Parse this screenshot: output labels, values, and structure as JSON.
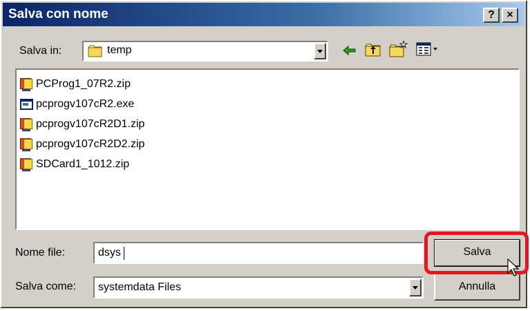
{
  "window": {
    "title": "Salva con nome",
    "help_label": "?",
    "close_label": "×"
  },
  "toolbar": {
    "save_in_label": "Salva in:",
    "save_in_value": "temp",
    "icons": [
      "back-arrow-icon",
      "up-folder-icon",
      "new-folder-icon",
      "view-menu-icon"
    ]
  },
  "files": [
    {
      "name": "PCProg1_07R2.zip",
      "icon": "zip-archive-icon"
    },
    {
      "name": "pcprogv107cR2.exe",
      "icon": "executable-icon"
    },
    {
      "name": "pcprogv107cR2D1.zip",
      "icon": "zip-archive-icon"
    },
    {
      "name": "pcprogv107cR2D2.zip",
      "icon": "zip-archive-icon"
    },
    {
      "name": "SDCard1_1012.zip",
      "icon": "zip-archive-icon"
    }
  ],
  "form": {
    "filename_label": "Nome file:",
    "filename_value": "dsys",
    "filetype_label": "Salva come:",
    "filetype_value": "systemdata Files"
  },
  "buttons": {
    "save": "Salva",
    "cancel": "Annulla"
  },
  "colors": {
    "titlebar": "#0a246a",
    "face": "#d4d0c8",
    "highlight": "#e8141e"
  }
}
